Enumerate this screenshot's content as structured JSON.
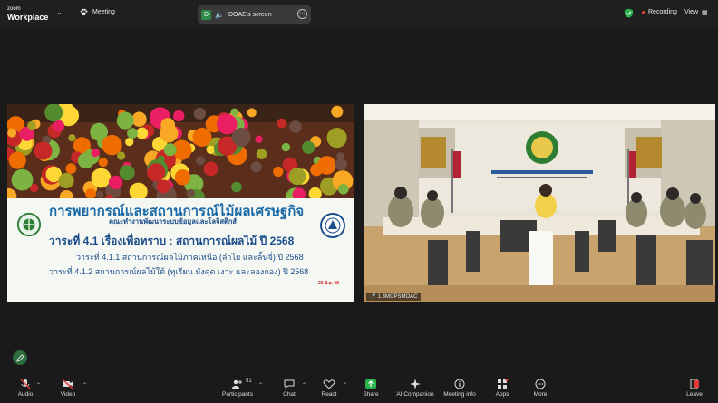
{
  "topbar": {
    "brand_small": "zoom",
    "brand_big": "Workplace",
    "meeting_label": "Meeting",
    "share_initial": "D",
    "share_label": "DOAE's screen",
    "recording_label": "Recording",
    "view_label": "View"
  },
  "slide": {
    "title": "การพยากรณ์และสถานการณ์ไม้ผลเศรษฐกิจ",
    "subtitle": "คณะทำงานพัฒนาระบบข้อมูลและโลจิสติกส์",
    "agenda_main": "วาระที่ 4.1 เรื่องเพื่อทราบ : สถานการณ์ผลไม้ ปี 2568",
    "agenda_1": "วาระที่ 4.1.1 สถานการณ์ผลไม้ภาคเหนือ (ลำไย และลิ้นจี่) ปี 2568",
    "agenda_2": "วาระที่ 4.1.2 สถานการณ์ผลไม้ใต้ (ทุเรียน มังคุด เงาะ และลองกอง) ปี 2568",
    "date": "23 มิ.ย. 68"
  },
  "participant": {
    "name": "1.3MOPSMOAC"
  },
  "toolbar": {
    "audio": "Audio",
    "video": "Video",
    "participants": "Participants",
    "participants_count": "51",
    "chat": "Chat",
    "react": "React",
    "share": "Share",
    "ai_companion": "AI Companion",
    "meeting_info": "Meeting info",
    "apps": "Apps",
    "more": "More",
    "leave": "Leave"
  },
  "colors": {
    "share_green": "#2d8c4a",
    "record_red": "#e53935",
    "slide_title_blue": "#1b6aa8"
  }
}
